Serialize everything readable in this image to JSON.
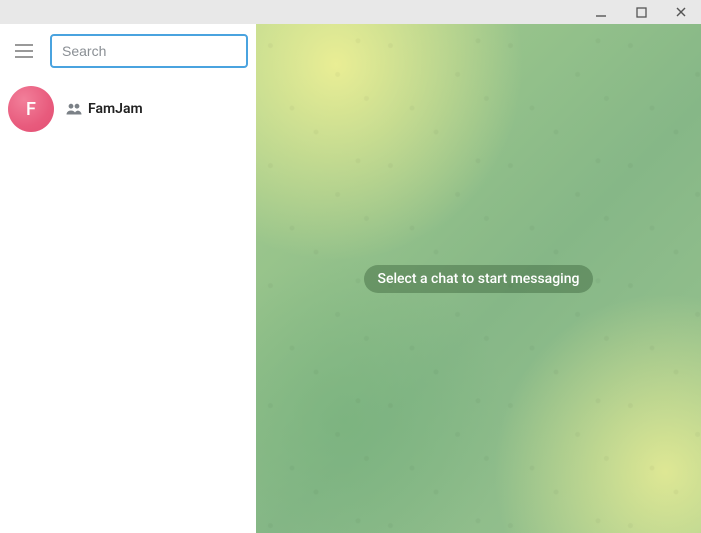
{
  "window_controls": {
    "minimize": "minimize",
    "maximize": "maximize",
    "close": "close"
  },
  "search": {
    "placeholder": "Search",
    "value": ""
  },
  "chats": [
    {
      "avatar_letter": "F",
      "name": "FamJam",
      "is_group": true
    }
  ],
  "main": {
    "empty_state": "Select a chat to start messaging"
  },
  "colors": {
    "search_border": "#4aa3df",
    "avatar_bg": "#e85b7d"
  }
}
